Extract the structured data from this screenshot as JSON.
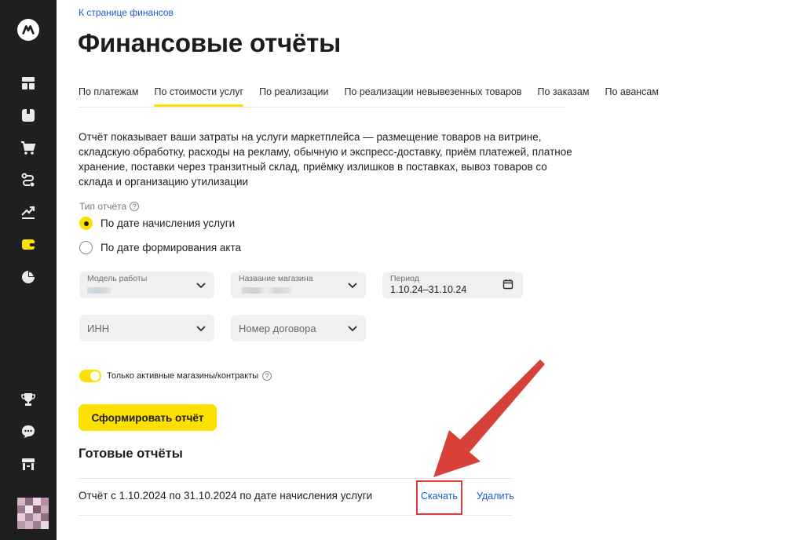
{
  "breadcrumb": "К странице финансов",
  "page_title": "Финансовые отчёты",
  "tabs": [
    {
      "label": "По платежам",
      "active": false
    },
    {
      "label": "По стоимости услуг",
      "active": true
    },
    {
      "label": "По реализации",
      "active": false
    },
    {
      "label": "По реализации невывезенных товаров",
      "active": false
    },
    {
      "label": "По заказам",
      "active": false
    },
    {
      "label": "По авансам",
      "active": false
    }
  ],
  "description": "Отчёт показывает ваши затраты на услуги маркетплейса — размещение товаров на витрине, складскую обработку, расходы на рекламу, обычную и экспресс-доставку, приём платежей, платное хранение, поставки через транзитный склад, приёмку излишков в поставках, вывоз товаров со склада и организацию утилизации",
  "report_type": {
    "label": "Тип отчёта",
    "options": [
      {
        "label": "По дате начисления услуги",
        "selected": true
      },
      {
        "label": "По дате формирования акта",
        "selected": false
      }
    ]
  },
  "filters": {
    "work_model": {
      "label": "Модель работы"
    },
    "store_name": {
      "label": "Название магазина"
    },
    "period": {
      "label": "Период",
      "value": "1.10.24–31.10.24"
    },
    "inn": {
      "placeholder": "ИНН"
    },
    "contract": {
      "placeholder": "Номер договора"
    }
  },
  "toggle": {
    "label": "Только активные магазины/контракты",
    "on": true
  },
  "generate_button": "Сформировать отчёт",
  "ready_reports": {
    "title": "Готовые отчёты",
    "rows": [
      {
        "text": "Отчёт с 1.10.2024 по 31.10.2024 по дате начисления услуги",
        "download": "Скачать",
        "delete": "Удалить"
      }
    ]
  },
  "colors": {
    "accent": "#fce000",
    "link": "#1a5bd6",
    "sidebar": "#1f1f1f",
    "annotation": "#d8403a"
  },
  "sidebar_icons": [
    "market-logo-icon",
    "dashboard-icon",
    "box-icon",
    "cart-icon",
    "logistics-icon",
    "trend-icon",
    "wallet-icon",
    "pie-chart-icon",
    "trophy-icon",
    "chat-icon",
    "store-icon"
  ]
}
